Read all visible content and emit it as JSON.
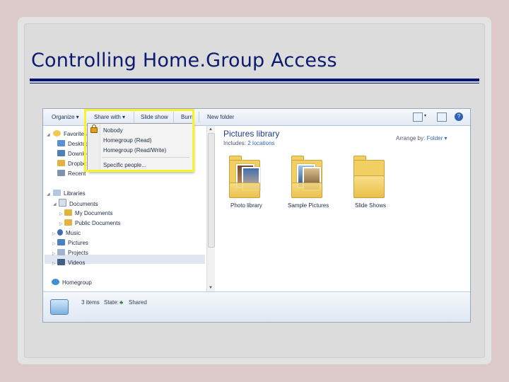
{
  "slide": {
    "title": "Controlling Home.Group Access"
  },
  "toolbar": {
    "organize": "Organize ▾",
    "share_with": "Share with ▾",
    "slide_show": "Slide show",
    "burn": "Burn",
    "new_folder": "New folder"
  },
  "share_menu": {
    "items": [
      "Nobody",
      "Homegroup (Read)",
      "Homegroup (Read/Write)",
      "Specific people..."
    ]
  },
  "nav": {
    "favorites": "Favorites",
    "fav_items": [
      "Desktop",
      "Downloads",
      "Dropbox",
      "Recent"
    ],
    "libraries": "Libraries",
    "documents": "Documents",
    "my_documents": "My Documents",
    "public_documents": "Public Documents",
    "music": "Music",
    "pictures": "Pictures",
    "projects": "Projects",
    "videos": "Videos",
    "homegroup": "Homegroup"
  },
  "content": {
    "title": "Pictures library",
    "includes_label": "Includes:",
    "includes_link": "2 locations",
    "arrange_label": "Arrange by:",
    "arrange_value": "Folder ▾",
    "folders": [
      "Photo library",
      "Sample Pictures",
      "Slide Shows"
    ]
  },
  "status": {
    "items": "3 items",
    "state_label": "State:",
    "state_value": "Shared"
  },
  "colors": {
    "title": "#0c1a6f",
    "highlight": "#f5f52a",
    "link": "#3366cc"
  }
}
